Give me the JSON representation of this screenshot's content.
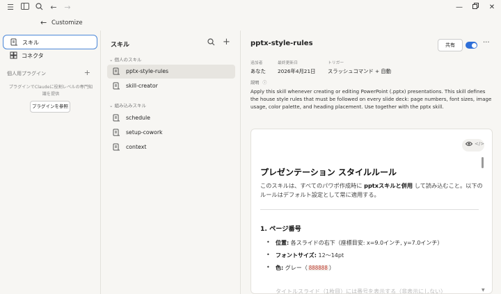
{
  "titlebar": {
    "icons": [
      "menu-icon",
      "sidebar-icon",
      "search-icon",
      "back-arrow-icon",
      "forward-arrow-icon"
    ],
    "window_controls": [
      "minimize-icon",
      "restore-icon",
      "close-icon"
    ]
  },
  "customize": {
    "label": "Customize"
  },
  "sidebar": {
    "items": [
      {
        "label": "スキル",
        "icon": "skill-icon",
        "active": true
      },
      {
        "label": "コネクタ",
        "icon": "connector-icon",
        "active": false
      }
    ],
    "plugins_heading": "個人用プラグイン",
    "plugins_desc": "プラグインでClaudeに役割レベルの専門知識を提供",
    "browse_button": "プラグインを参照"
  },
  "middle": {
    "title": "スキル",
    "personal_heading": "個人のスキル",
    "personal_skills": [
      {
        "label": "pptx-style-rules",
        "active": true
      },
      {
        "label": "skill-creator",
        "active": false
      }
    ],
    "builtin_heading": "組み込みスキル",
    "builtin_skills": [
      {
        "label": "schedule"
      },
      {
        "label": "setup-cowork"
      },
      {
        "label": "context"
      }
    ]
  },
  "detail": {
    "name": "pptx-style-rules",
    "share_label": "共有",
    "enabled": true,
    "meta": {
      "added_by_label": "追加者",
      "added_by": "あなた",
      "updated_label": "最終更新日",
      "updated": "2026年4月21日",
      "trigger_label": "トリガー",
      "trigger": "スラッシュコマンド + 自動"
    },
    "desc_label": "説明",
    "description": "Apply this skill whenever creating or editing PowerPoint (.pptx) presentations. This skill defines the house style rules that must be followed on every slide deck: page numbers, font sizes, image usage, color palette, and heading placement. Use together with the pptx skill."
  },
  "doc": {
    "h1": "プレゼンテーション スタイルルール",
    "intro_pre": "このスキルは、すべてのパワポ作成時に ",
    "intro_bold": "pptxスキルと併用",
    "intro_post": " して読み込むこと。以下のルールはデフォルト設定として常に適用する。",
    "h2": "1. ページ番号",
    "bullets": [
      {
        "bold": "位置:",
        "text": " 各スライドの右下（座標目安: x=9.0インチ, y=7.0インチ）"
      },
      {
        "bold": "フォントサイズ:",
        "text": " 12〜14pt"
      },
      {
        "bold": "色:",
        "text": " グレー（",
        "code": "888888",
        "tail": "）"
      }
    ],
    "cut_line": "タイトルスライド（1枚目）には番号を表示する（非表示にしない）"
  }
}
